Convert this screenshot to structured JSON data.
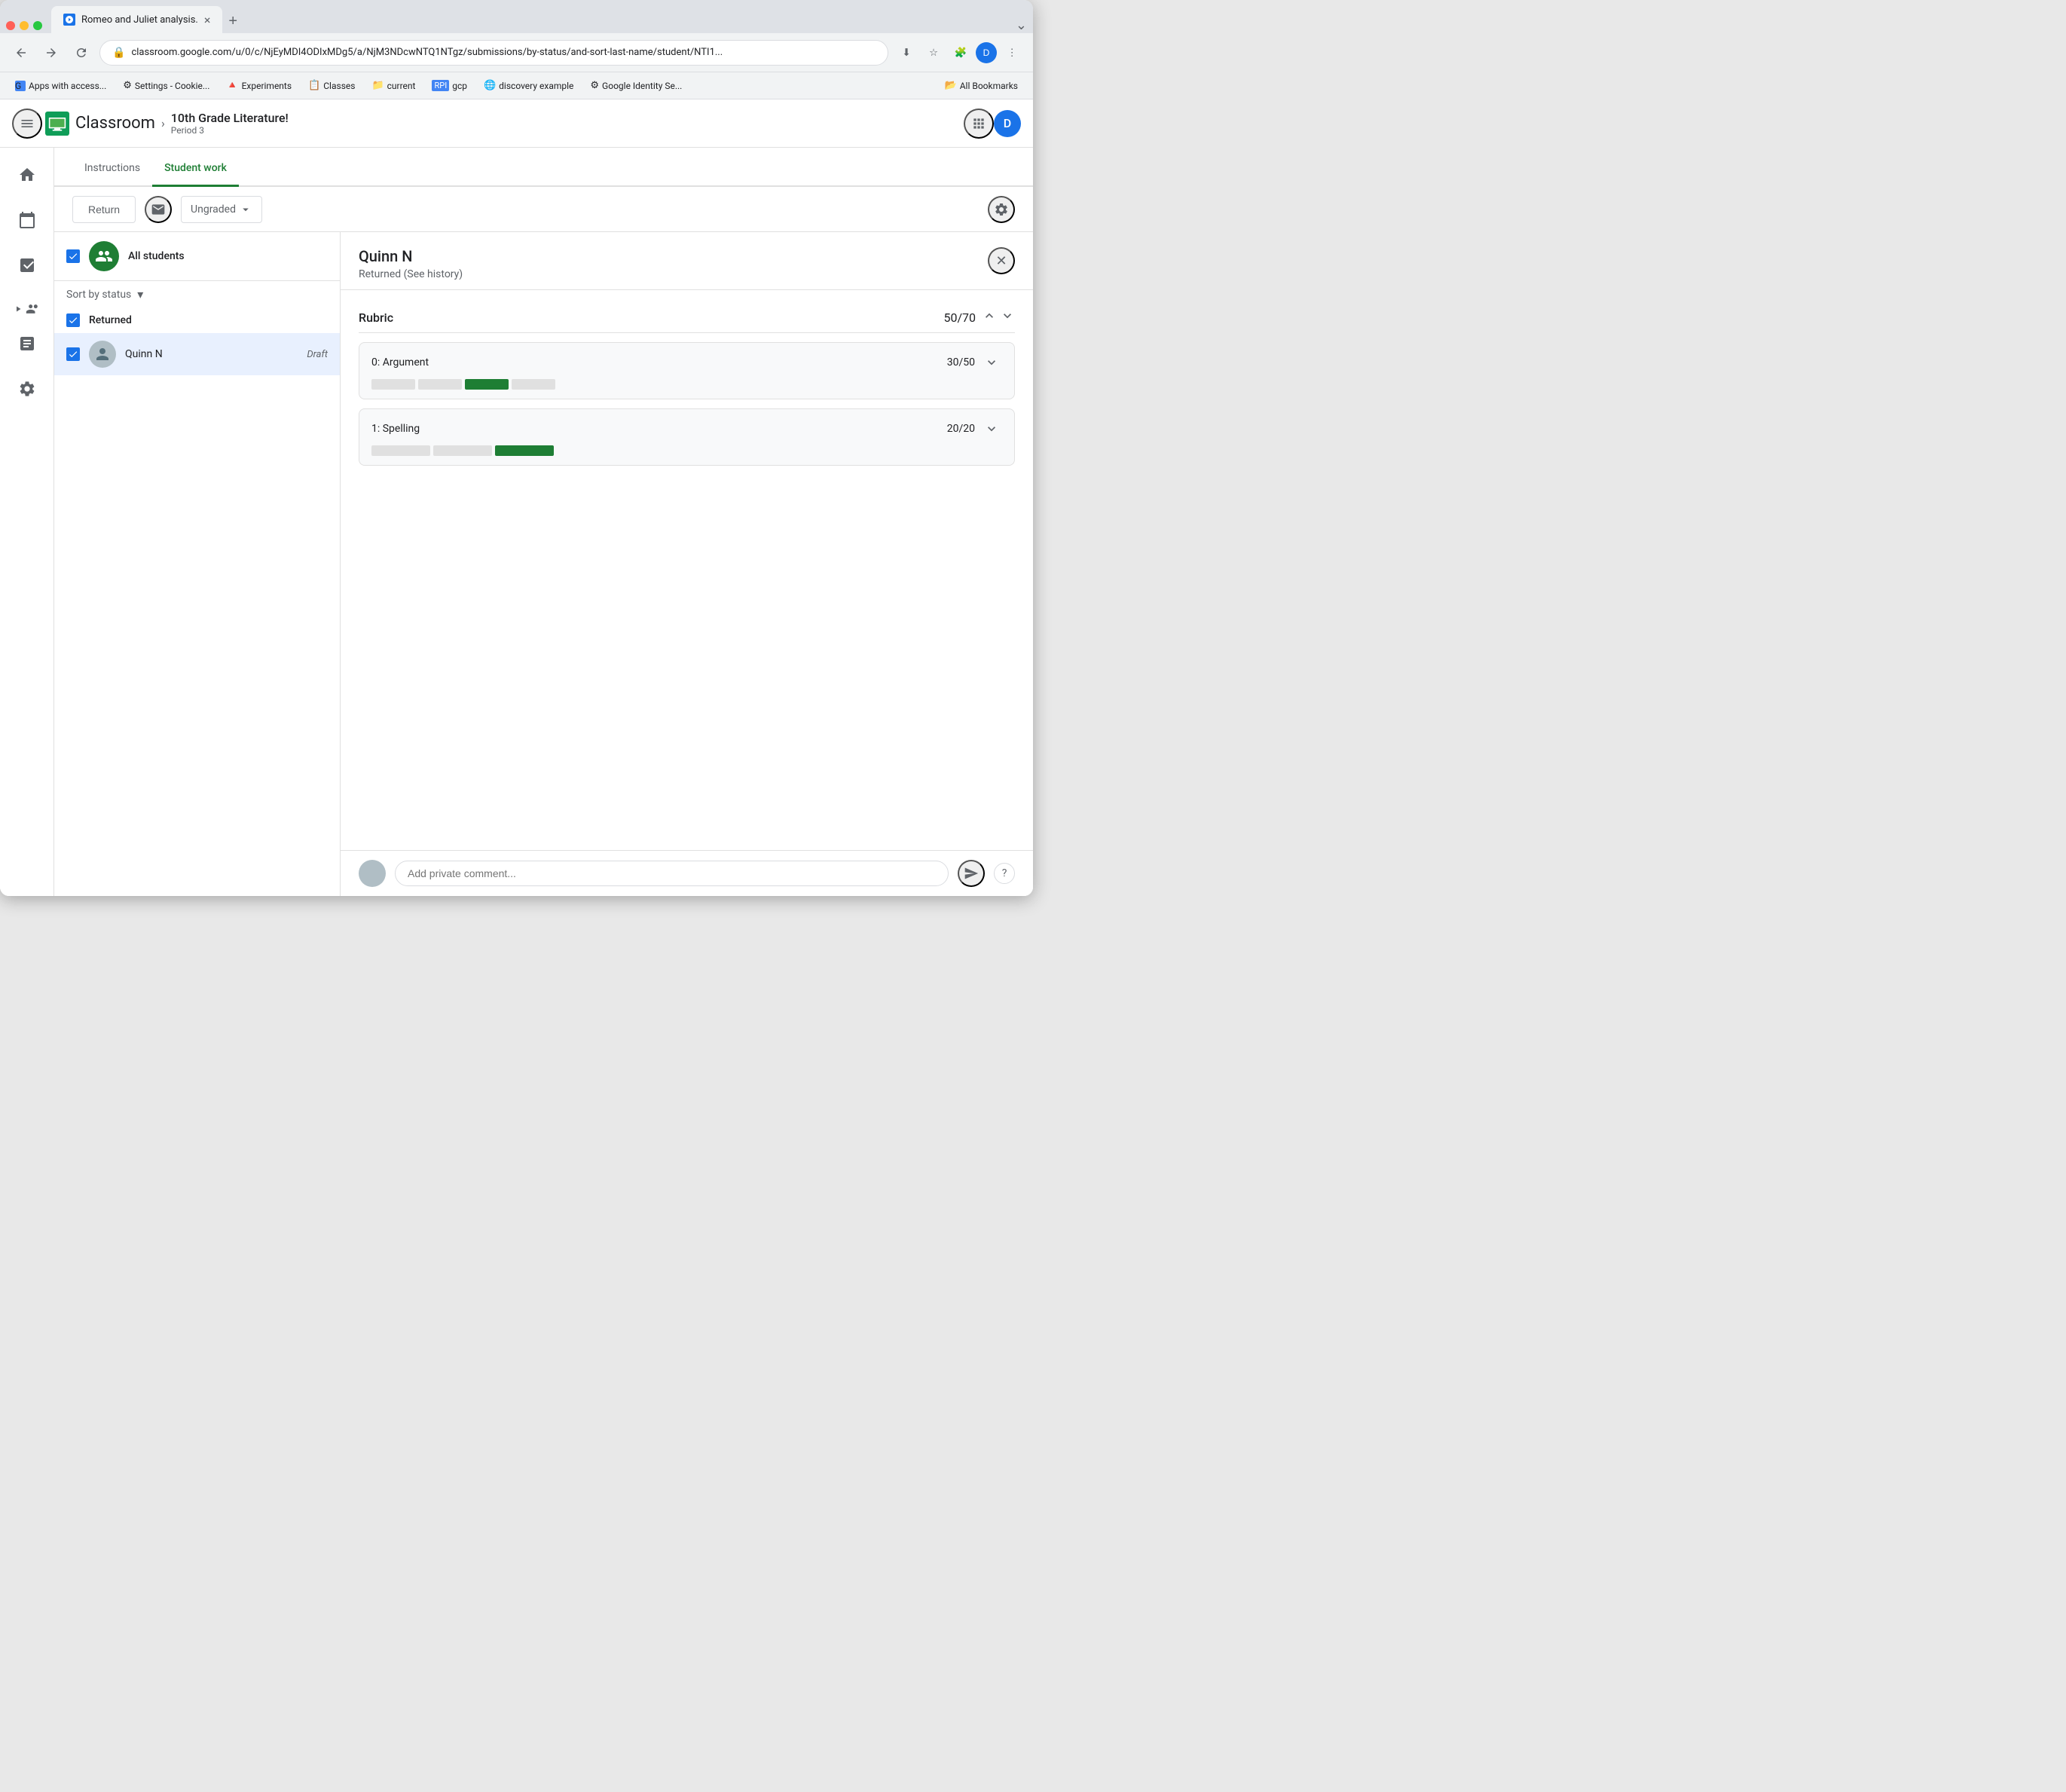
{
  "browser": {
    "tab": {
      "title": "Romeo and Juliet analysis.",
      "close_label": "×",
      "new_tab_label": "+"
    },
    "url": "classroom.google.com/u/0/c/NjEyMDI4ODIxMDg5/a/NjM3NDcwNTQ1NTgz/submissions/by-status/and-sort-last-name/student/NTI1...",
    "bookmarks": [
      {
        "label": "Apps with access...",
        "color": "#4285f4"
      },
      {
        "label": "Settings - Cookie...",
        "color": "#9e9e9e"
      },
      {
        "label": "Experiments",
        "color": "#ff6d00"
      },
      {
        "label": "Classes",
        "color": "#fbbc04"
      },
      {
        "label": "current",
        "color": "#9e9e9e"
      },
      {
        "label": "gcp",
        "color": "#4285f4"
      },
      {
        "label": "discovery example",
        "color": "#9e9e9e"
      },
      {
        "label": "Google Identity Se...",
        "color": "#4285f4"
      },
      {
        "label": "All Bookmarks",
        "color": "#9e9e9e"
      }
    ]
  },
  "app": {
    "title": "Classroom",
    "course": {
      "name": "10th Grade Literature!",
      "period": "Period 3"
    },
    "avatar_label": "D"
  },
  "tabs": {
    "instructions": "Instructions",
    "student_work": "Student work"
  },
  "toolbar": {
    "return_label": "Return",
    "grade_label": "Ungraded"
  },
  "student_list": {
    "all_students_label": "All students",
    "sort_label": "Sort by status",
    "section_label": "Returned",
    "students": [
      {
        "name": "Quinn N",
        "status": "Draft"
      }
    ]
  },
  "detail": {
    "student_name": "Quinn N",
    "status": "Returned (See history)",
    "rubric": {
      "title": "Rubric",
      "total_score": "50",
      "total_max": "70",
      "items": [
        {
          "name": "0: Argument",
          "score": "30",
          "max": "50",
          "segments": [
            {
              "width": 60,
              "filled": false
            },
            {
              "width": 60,
              "filled": false
            },
            {
              "width": 60,
              "filled": true
            },
            {
              "width": 60,
              "filled": false
            }
          ]
        },
        {
          "name": "1: Spelling",
          "score": "20",
          "max": "20",
          "segments": [
            {
              "width": 80,
              "filled": false
            },
            {
              "width": 80,
              "filled": false
            },
            {
              "width": 80,
              "filled": true
            }
          ]
        }
      ]
    },
    "comment_placeholder": "Add private comment..."
  }
}
